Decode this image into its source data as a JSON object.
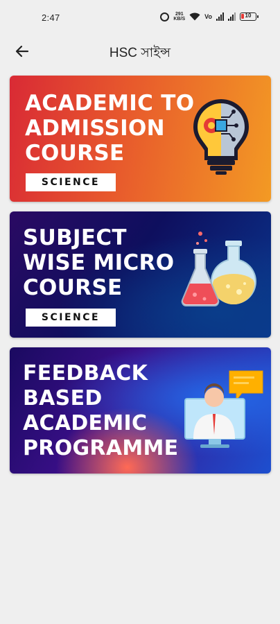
{
  "status_bar": {
    "time": "2:47",
    "speed": "291\nKB/S",
    "network": "Vo",
    "battery": "10",
    "icons": [
      "alarm-icon",
      "wifi-icon",
      "signal-icon",
      "battery-icon"
    ]
  },
  "app_bar": {
    "title": "HSC সাইন্স",
    "back_icon": "arrow-left-icon"
  },
  "cards": [
    {
      "title": "ACADEMIC TO\nADMISSION\nCOURSE",
      "tag": "SCIENCE",
      "illustration": "lightbulb-gear-circuit-icon",
      "colors": {
        "from": "#d92a35",
        "to": "#f39a24"
      }
    },
    {
      "title": "SUBJECT\nWISE MICRO\nCOURSE",
      "tag": "SCIENCE",
      "illustration": "lab-flasks-icon",
      "colors": {
        "from": "#2a0a63",
        "to": "#0b3790"
      }
    },
    {
      "title": "FEEDBACK\nBASED\nACADEMIC\nPROGRAMME",
      "illustration": "online-teacher-chat-icon",
      "colors": {
        "from": "#1a0a60",
        "to": "#1d4fcf"
      }
    }
  ]
}
